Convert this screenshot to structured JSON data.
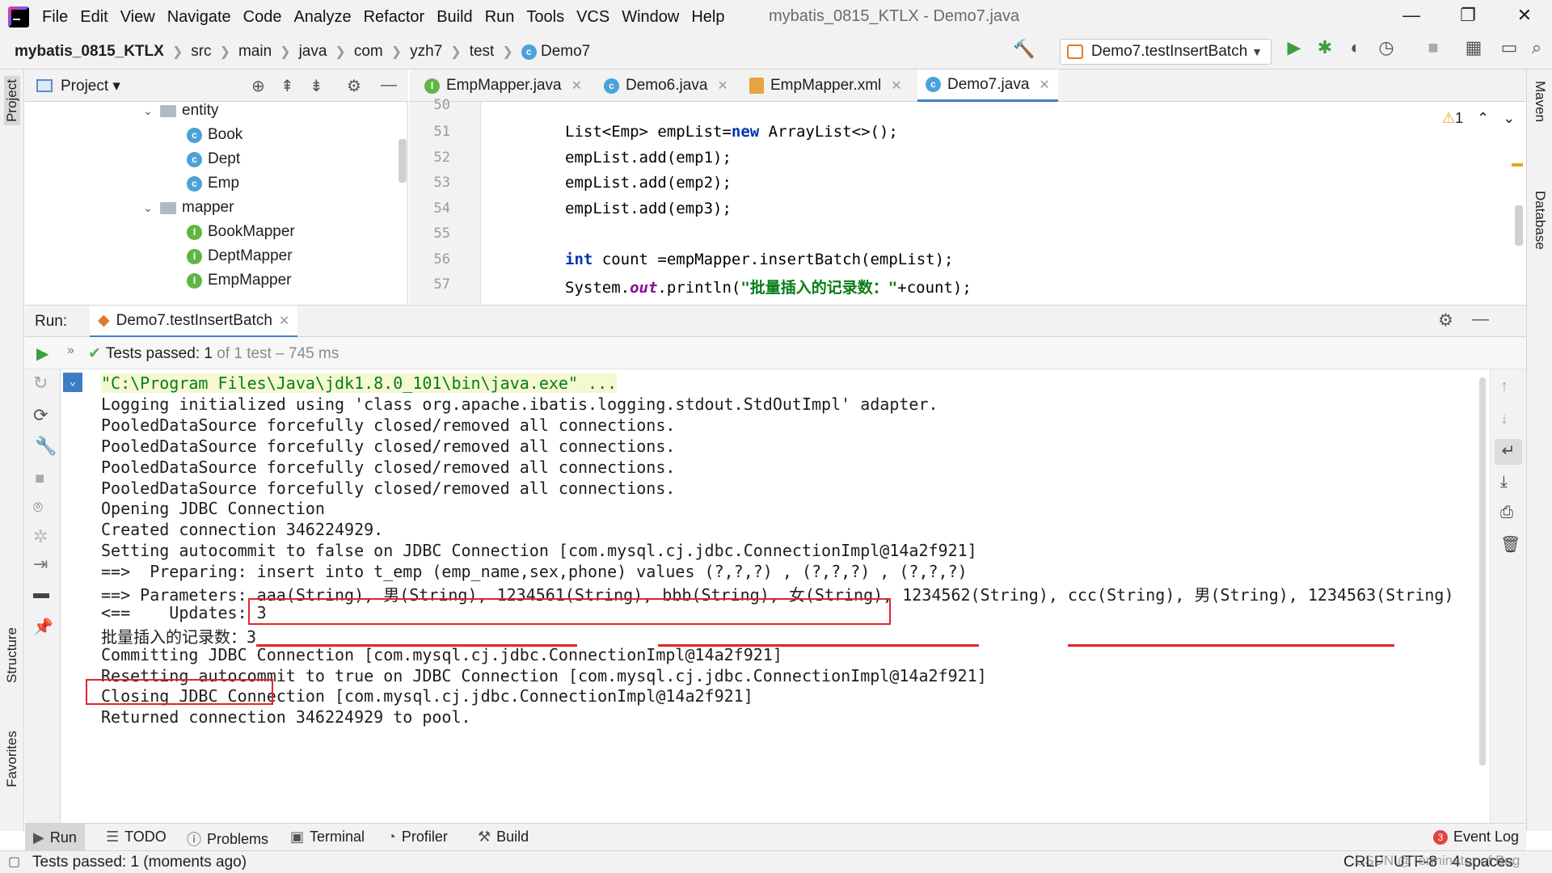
{
  "menubar": {
    "menus": [
      "File",
      "Edit",
      "View",
      "Navigate",
      "Code",
      "Analyze",
      "Refactor",
      "Build",
      "Run",
      "Tools",
      "VCS",
      "Window",
      "Help"
    ],
    "title": "mybatis_0815_KTLX - Demo7.java"
  },
  "navbar": {
    "crumbs": [
      "mybatis_0815_KTLX",
      "src",
      "main",
      "java",
      "com",
      "yzh7",
      "test",
      "Demo7"
    ],
    "run_config": "Demo7.testInsertBatch"
  },
  "left_strip": {
    "project": "Project",
    "structure": "Structure",
    "favorites": "Favorites"
  },
  "right_strip": {
    "maven": "Maven",
    "database": "Database"
  },
  "project": {
    "title": "Project",
    "tree": [
      {
        "label": "entity",
        "kind": "folder"
      },
      {
        "label": "Book",
        "kind": "class"
      },
      {
        "label": "Dept",
        "kind": "class"
      },
      {
        "label": "Emp",
        "kind": "class"
      },
      {
        "label": "mapper",
        "kind": "folder"
      },
      {
        "label": "BookMapper",
        "kind": "interface"
      },
      {
        "label": "DeptMapper",
        "kind": "interface"
      },
      {
        "label": "EmpMapper",
        "kind": "interface"
      }
    ]
  },
  "editor": {
    "tabs": [
      {
        "label": "EmpMapper.java",
        "icon": "interface-icon"
      },
      {
        "label": "Demo6.java",
        "icon": "class-icon"
      },
      {
        "label": "EmpMapper.xml",
        "icon": "xml-icon"
      },
      {
        "label": "Demo7.java",
        "icon": "class-icon",
        "active": true
      }
    ],
    "warning_count": "1",
    "line_numbers": [
      "50",
      "51",
      "52",
      "53",
      "54",
      "55",
      "56",
      "57"
    ]
  },
  "run": {
    "label": "Run:",
    "tab": "Demo7.testInsertBatch",
    "tests_passed_label": "Tests passed:",
    "tests_passed_count": "1",
    "tests_summary": "of 1 test – 745 ms",
    "console": [
      "\"C:\\Program Files\\Java\\jdk1.8.0_101\\bin\\java.exe\" ...",
      "Logging initialized using 'class org.apache.ibatis.logging.stdout.StdOutImpl' adapter.",
      "PooledDataSource forcefully closed/removed all connections.",
      "PooledDataSource forcefully closed/removed all connections.",
      "PooledDataSource forcefully closed/removed all connections.",
      "PooledDataSource forcefully closed/removed all connections.",
      "Opening JDBC Connection",
      "Created connection 346224929.",
      "Setting autocommit to false on JDBC Connection [com.mysql.cj.jdbc.ConnectionImpl@14a2f921]",
      "==>  Preparing: insert into t_emp (emp_name,sex,phone) values (?,?,?) , (?,?,?) , (?,?,?)",
      "==> Parameters: aaa(String), 男(String), 1234561(String), bbb(String), 女(String), 1234562(String), ccc(String), 男(String), 1234563(String)",
      "<==    Updates: 3",
      "批量插入的记录数：3",
      "Committing JDBC Connection [com.mysql.cj.jdbc.ConnectionImpl@14a2f921]",
      "Resetting autocommit to true on JDBC Connection [com.mysql.cj.jdbc.ConnectionImpl@14a2f921]",
      "Closing JDBC Connection [com.mysql.cj.jdbc.ConnectionImpl@14a2f921]",
      "Returned connection 346224929 to pool."
    ]
  },
  "bottom_tabs": [
    "Run",
    "TODO",
    "Problems",
    "Terminal",
    "Profiler",
    "Build",
    "Event Log"
  ],
  "event_log_count": "3",
  "status": {
    "message": "Tests passed: 1 (moments ago)",
    "line_sep": "CRLF",
    "encoding": "UTF-8",
    "indent": "4 spaces",
    "watermark": "CSDN @Terminator of Bug"
  },
  "colors": {
    "accent": "#4083c9",
    "annotation": "#e0262b",
    "pass": "#59a869"
  }
}
